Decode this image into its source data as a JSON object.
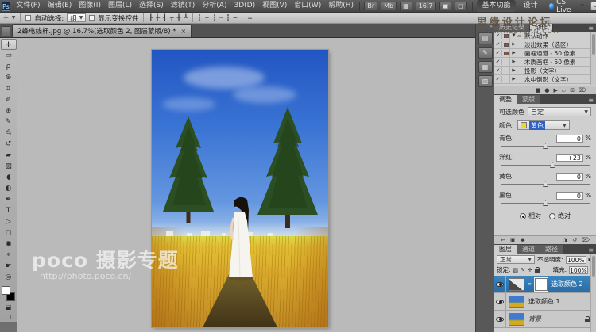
{
  "window": {
    "watermark_line1": "思缘设计论坛",
    "watermark_line2": "WWW.MISSYUAN.COM",
    "minimize": "—",
    "restore": "□",
    "close": "✕"
  },
  "menu_bar": {
    "logo": "Ps",
    "items": [
      {
        "label": "文件(F)"
      },
      {
        "label": "编辑(E)"
      },
      {
        "label": "图像(I)"
      },
      {
        "label": "图层(L)"
      },
      {
        "label": "选择(S)"
      },
      {
        "label": "滤镜(T)"
      },
      {
        "label": "分析(A)"
      },
      {
        "label": "3D(D)"
      },
      {
        "label": "视图(V)"
      },
      {
        "label": "窗口(W)"
      },
      {
        "label": "帮助(H)"
      }
    ],
    "bridge_icon": "Br",
    "minibridge_icon": "Mb",
    "view_extras_icon": "▦",
    "zoom_level": "16.7",
    "arrange_icon": "▣",
    "screen_mode_icon": "▢",
    "workspaces": [
      {
        "label": "基本功能",
        "active": true
      },
      {
        "label": "设计",
        "active": false
      }
    ],
    "cs_live_label": "CS Live",
    "caret": "▼"
  },
  "options_bar": {
    "tool_icon": "✛",
    "auto_select_label": "自动选择:",
    "auto_select_value": "组",
    "show_transform_label": "显示变换控件",
    "align_icons": [
      {
        "glyph": "┠"
      },
      {
        "glyph": "┼"
      },
      {
        "glyph": "┨"
      },
      {
        "glyph": "┰"
      },
      {
        "glyph": "╂"
      },
      {
        "glyph": "┸"
      }
    ],
    "distribute_icons": [
      {
        "glyph": "┆"
      },
      {
        "glyph": "╌"
      },
      {
        "glyph": "┆"
      },
      {
        "glyph": "┄"
      },
      {
        "glyph": "┇"
      },
      {
        "glyph": "┉"
      }
    ],
    "auto_align_icon": "≈"
  },
  "document_tab": {
    "title": "2蜂电线杆.jpg @ 16.7%(选取颜色 2, 图层蒙版/8) *",
    "close_icon": "×"
  },
  "tools": [
    {
      "glyph": "✛",
      "name": "move-tool",
      "selected": true
    },
    {
      "glyph": "▭",
      "name": "marquee-tool",
      "selected": false
    },
    {
      "glyph": "ρ",
      "name": "lasso-tool",
      "selected": false
    },
    {
      "glyph": "⊛",
      "name": "quick-selection-tool",
      "selected": false
    },
    {
      "glyph": "⌗",
      "name": "crop-tool",
      "selected": false
    },
    {
      "glyph": "✐",
      "name": "eyedropper-tool",
      "selected": false
    },
    {
      "glyph": "⊕",
      "name": "healing-brush-tool",
      "selected": false
    },
    {
      "glyph": "✎",
      "name": "brush-tool",
      "selected": false
    },
    {
      "glyph": "⎙",
      "name": "clone-stamp-tool",
      "selected": false
    },
    {
      "glyph": "↺",
      "name": "history-brush-tool",
      "selected": false
    },
    {
      "glyph": "▰",
      "name": "eraser-tool",
      "selected": false
    },
    {
      "glyph": "▨",
      "name": "gradient-tool",
      "selected": false
    },
    {
      "glyph": "◖",
      "name": "blur-tool",
      "selected": false
    },
    {
      "glyph": "◐",
      "name": "dodge-tool",
      "selected": false
    },
    {
      "glyph": "✒",
      "name": "pen-tool",
      "selected": false
    },
    {
      "glyph": "T",
      "name": "type-tool",
      "selected": false
    },
    {
      "glyph": "▷",
      "name": "path-selection-tool",
      "selected": false
    },
    {
      "glyph": "◻",
      "name": "shape-tool",
      "selected": false
    },
    {
      "glyph": "◉",
      "name": "3d-rotate-tool",
      "selected": false
    },
    {
      "glyph": "⌖",
      "name": "3d-roll-tool",
      "selected": false
    },
    {
      "glyph": "☛",
      "name": "hand-tool",
      "selected": false
    },
    {
      "glyph": "◎",
      "name": "zoom-tool",
      "selected": false
    }
  ],
  "color_swatches": {
    "foreground": "#ffffff",
    "background": "#000000"
  },
  "tools_extra": {
    "quick_mask_icon": "⬓",
    "screen_mode_icon": "▢"
  },
  "canvas": {
    "watermark_title": "poco 摄影专题",
    "watermark_url": "http://photo.poco.cn/"
  },
  "dock_icons": [
    {
      "glyph": "▤",
      "name": "styles-panel-icon"
    },
    {
      "glyph": "✎",
      "name": "brush-panel-icon"
    },
    {
      "glyph": "▦",
      "name": "clone-source-panel-icon"
    },
    {
      "glyph": "▧",
      "name": "character-panel-icon"
    }
  ],
  "dock_collapse_icon": "«",
  "actions_panel": {
    "tabs": [
      {
        "label": "历史记录",
        "active": false
      },
      {
        "label": "动作",
        "active": true
      }
    ],
    "menu_icon": "≡",
    "rows": [
      {
        "check": "✓",
        "dialog": true,
        "expander": "▼",
        "icon": "▱",
        "label": "默认动作"
      },
      {
        "check": "✓",
        "dialog": true,
        "expander": "▶",
        "icon": "",
        "label": "淡出效果（选区）"
      },
      {
        "check": "✓",
        "dialog": true,
        "expander": "▶",
        "icon": "",
        "label": "画框通道 - 50 像素"
      },
      {
        "check": "✓",
        "dialog": false,
        "expander": "▶",
        "icon": "",
        "label": "木质画框 - 50 像素"
      },
      {
        "check": "✓",
        "dialog": false,
        "expander": "▶",
        "icon": "",
        "label": "投影（文字）"
      },
      {
        "check": "✓",
        "dialog": false,
        "expander": "▶",
        "icon": "",
        "label": "水中倒影（文字）"
      }
    ],
    "footer_icons": [
      {
        "glyph": "■",
        "name": "stop-icon"
      },
      {
        "glyph": "●",
        "name": "record-icon"
      },
      {
        "glyph": "▶",
        "name": "play-icon"
      },
      {
        "glyph": "▱",
        "name": "new-set-icon"
      },
      {
        "glyph": "⊞",
        "name": "new-action-icon"
      },
      {
        "glyph": "⌦",
        "name": "delete-icon"
      }
    ]
  },
  "adjustments_panel": {
    "tabs": [
      {
        "label": "调整",
        "active": true
      },
      {
        "label": "蒙版",
        "active": false
      }
    ],
    "menu_icon": "≡",
    "type_label": "可选颜色",
    "preset_value": "自定",
    "color_label": "颜色:",
    "color_value": "黄色",
    "color_swatch": "#eed72e",
    "percent": "%",
    "sliders": [
      {
        "label": "青色:",
        "value": "0",
        "pos": 50
      },
      {
        "label": "洋红:",
        "value": "+23",
        "pos": 58
      },
      {
        "label": "黄色:",
        "value": "0",
        "pos": 50
      },
      {
        "label": "黑色:",
        "value": "0",
        "pos": 50
      }
    ],
    "radio_relative": "相对",
    "radio_absolute": "绝对",
    "footer_left": [
      {
        "glyph": "↩",
        "name": "return-to-adjustment-list-icon"
      },
      {
        "glyph": "▣",
        "name": "clip-to-layer-icon"
      },
      {
        "glyph": "◉",
        "name": "toggle-visibility-icon"
      }
    ],
    "footer_right": [
      {
        "glyph": "◑",
        "name": "view-previous-state-icon"
      },
      {
        "glyph": "↺",
        "name": "reset-icon"
      },
      {
        "glyph": "⌦",
        "name": "delete-adjustment-icon"
      }
    ]
  },
  "layers_panel": {
    "tabs": [
      {
        "label": "图层",
        "active": true
      },
      {
        "label": "通道",
        "active": false
      },
      {
        "label": "路径",
        "active": false
      }
    ],
    "menu_icon": "≡",
    "blend_mode": "正常",
    "opacity_label": "不透明度:",
    "opacity_value": "100%",
    "lock_label": "锁定:",
    "fill_label": "填充:",
    "fill_value": "100%",
    "link_icon": "∞",
    "layers": [
      {
        "name": "选取颜色 2"
      },
      {
        "name": "选取颜色 1"
      },
      {
        "name": "背景"
      }
    ]
  }
}
